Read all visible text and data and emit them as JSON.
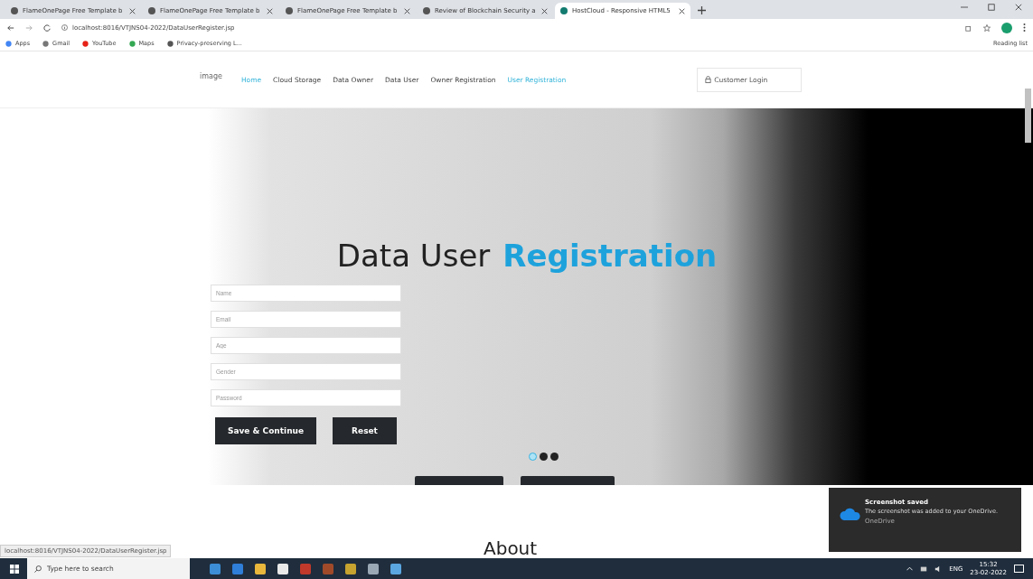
{
  "browser": {
    "tabs": [
      {
        "title": "FlameOnePage Free Template b",
        "selected": false
      },
      {
        "title": "FlameOnePage Free Template b",
        "selected": false
      },
      {
        "title": "FlameOnePage Free Template b",
        "selected": false
      },
      {
        "title": "Review of Blockchain Security a",
        "selected": false
      },
      {
        "title": "HostCloud - Responsive HTML5",
        "selected": true
      }
    ],
    "address": "localhost:8016/VTJNS04-2022/DataUserRegister.jsp",
    "bookmarks": [
      "Apps",
      "Gmail",
      "YouTube",
      "Maps",
      "Privacy-preserving L..."
    ],
    "reading_list": "Reading list",
    "status_url": "localhost:8016/VTJNS04-2022/DataUserRegister.jsp"
  },
  "navbar": {
    "logo_alt": "image",
    "links": [
      {
        "label": "Home",
        "highlighted": true
      },
      {
        "label": "Cloud Storage",
        "highlighted": false
      },
      {
        "label": "Data Owner",
        "highlighted": false
      },
      {
        "label": "Data User",
        "highlighted": false
      },
      {
        "label": "Owner Registration",
        "highlighted": false
      },
      {
        "label": "User Registration",
        "highlighted": true
      }
    ],
    "login": "Customer Login"
  },
  "hero": {
    "title": "Data User",
    "title_accent": "Registration",
    "fields": [
      {
        "placeholder": "Name"
      },
      {
        "placeholder": "Email"
      },
      {
        "placeholder": "Age"
      },
      {
        "placeholder": "Gender"
      },
      {
        "placeholder": "Password"
      }
    ],
    "buttons": [
      "Save & Continue",
      "Reset"
    ],
    "dots": [
      {
        "selected": true
      },
      {
        "selected": false
      },
      {
        "selected": false
      }
    ]
  },
  "next_heading": "About",
  "toast": {
    "title": "Screenshot saved",
    "message": "The screenshot was added to your OneDrive.",
    "source": "OneDrive"
  },
  "taskbar": {
    "search_placeholder": "Type here to search",
    "language": "ENG",
    "time": "15:32",
    "date": "23-02-2022"
  }
}
